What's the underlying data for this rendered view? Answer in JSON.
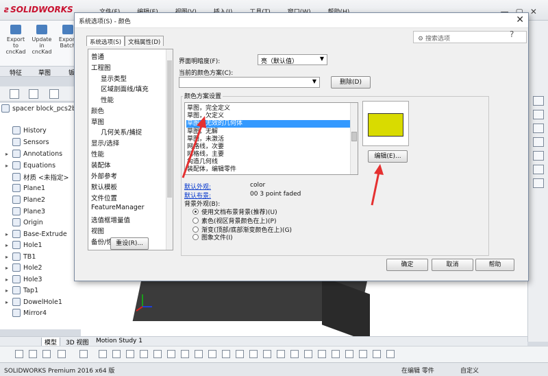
{
  "app": {
    "logo": "SOLIDWORKS",
    "menu": [
      "文件(F)",
      "编辑(E)",
      "视图(V)",
      "插入(I)",
      "工具(T)",
      "窗口(W)",
      "帮助(H)"
    ],
    "ribbon_buttons": [
      "Export to cncKad",
      "Update in cncKad",
      "Export Batch"
    ],
    "cm_tabs": [
      "特征",
      "草图",
      "钣"
    ],
    "tree": {
      "part_name": "spacer block_pcs2b",
      "items": [
        "History",
        "Sensors",
        "Annotations",
        "Equations",
        "材质 <未指定>",
        "Plane1",
        "Plane2",
        "Plane3",
        "Origin",
        "Base-Extrude",
        "Hole1",
        "TB1",
        "Hole2",
        "Hole3",
        "Tap1",
        "DowelHole1",
        "Mirror4"
      ]
    },
    "bottom_tabs": [
      "模型",
      "3D 视图",
      "Motion Study 1"
    ],
    "status": {
      "product": "SOLIDWORKS Premium 2016 x64 版",
      "mode": "在编辑 零件",
      "custom": "自定义"
    }
  },
  "dialog": {
    "title": "系统选项(S) - 颜色",
    "tabs": [
      "系统选项(S)",
      "文档属性(D)"
    ],
    "search_placeholder": "搜索选项",
    "categories": [
      "普通",
      "工程图",
      "显示类型",
      "区域剖面线/填充",
      "性能",
      "颜色",
      "草图",
      "几何关系/捕捉",
      "显示/选择",
      "性能",
      "装配体",
      "外部参考",
      "默认模板",
      "文件位置",
      "FeatureManager",
      "选值框增量值",
      "视图",
      "备份/恢复"
    ],
    "reset_button": "重设(R)...",
    "brightness_label": "界面明暗度(F):",
    "brightness_value": "亮（默认值）",
    "scheme_label": "当前的颜色方案(C):",
    "scheme_value": "",
    "delete_button": "删除(D)",
    "settings_label": "颜色方案设置",
    "scheme_items": [
      "草图，完全定义",
      "草图，欠定义",
      "草图，无效的几何体",
      "草图，无解",
      "草图，未激活",
      "网格线，次要",
      "网格线，主要",
      "构造几何线",
      "装配体，编辑零件"
    ],
    "selected_index": 2,
    "preview_color": "#d9db00",
    "edit_button": "编辑(E)...",
    "default_appearance_label": "默认外观:",
    "default_appearance_value": "color",
    "default_scene_label": "默认布景:",
    "default_scene_value": "00 3 point faded",
    "background_label": "背景外观(B):",
    "background_options": [
      "使用文档布景背景(推荐)(U)",
      "素色(视区背景颜色在上)(P)",
      "渐变(顶部/底部渐变颜色在上)(G)",
      "图象文件(I)"
    ],
    "background_selected": 0,
    "ok_button": "确定",
    "cancel_button": "取消",
    "help_button": "帮助"
  }
}
